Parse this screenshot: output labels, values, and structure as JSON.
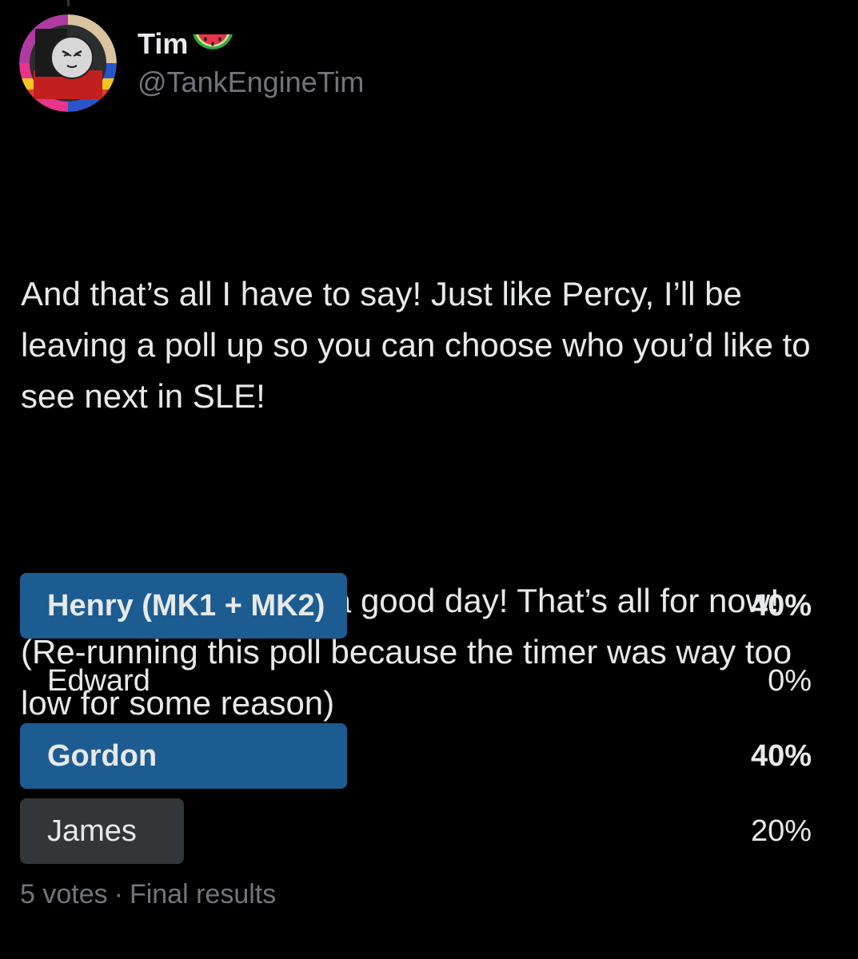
{
  "author": {
    "display_name": "Tim",
    "name_emoji": "watermelon-icon",
    "handle": "@TankEngineTim",
    "avatar_icon": "tank-engine-avatar-icon"
  },
  "tweet": {
    "paragraphs": [
      "And that’s all I have to say! Just like Percy, I’ll be leaving a poll up so you can choose who you’d like to see next in SLE!",
      "Take care, and have a good day! That’s all for now! (Re-running this poll because the timer was way too low for some reason)"
    ]
  },
  "poll": {
    "options": [
      {
        "label": "Henry (MK1 + MK2)",
        "percent_label": "40%",
        "percent": 40,
        "winner": true
      },
      {
        "label": "Edward",
        "percent_label": "0%",
        "percent": 0,
        "winner": false
      },
      {
        "label": "Gordon",
        "percent_label": "40%",
        "percent": 40,
        "winner": true
      },
      {
        "label": "James",
        "percent_label": "20%",
        "percent": 20,
        "winner": false
      }
    ],
    "votes": "5 votes",
    "separator": "·",
    "status": "Final results"
  },
  "colors": {
    "background": "#000000",
    "text": "#e7e9ea",
    "secondary_text": "#71767b",
    "winner_bar": "#1d5c91",
    "other_bar": "#333639"
  }
}
